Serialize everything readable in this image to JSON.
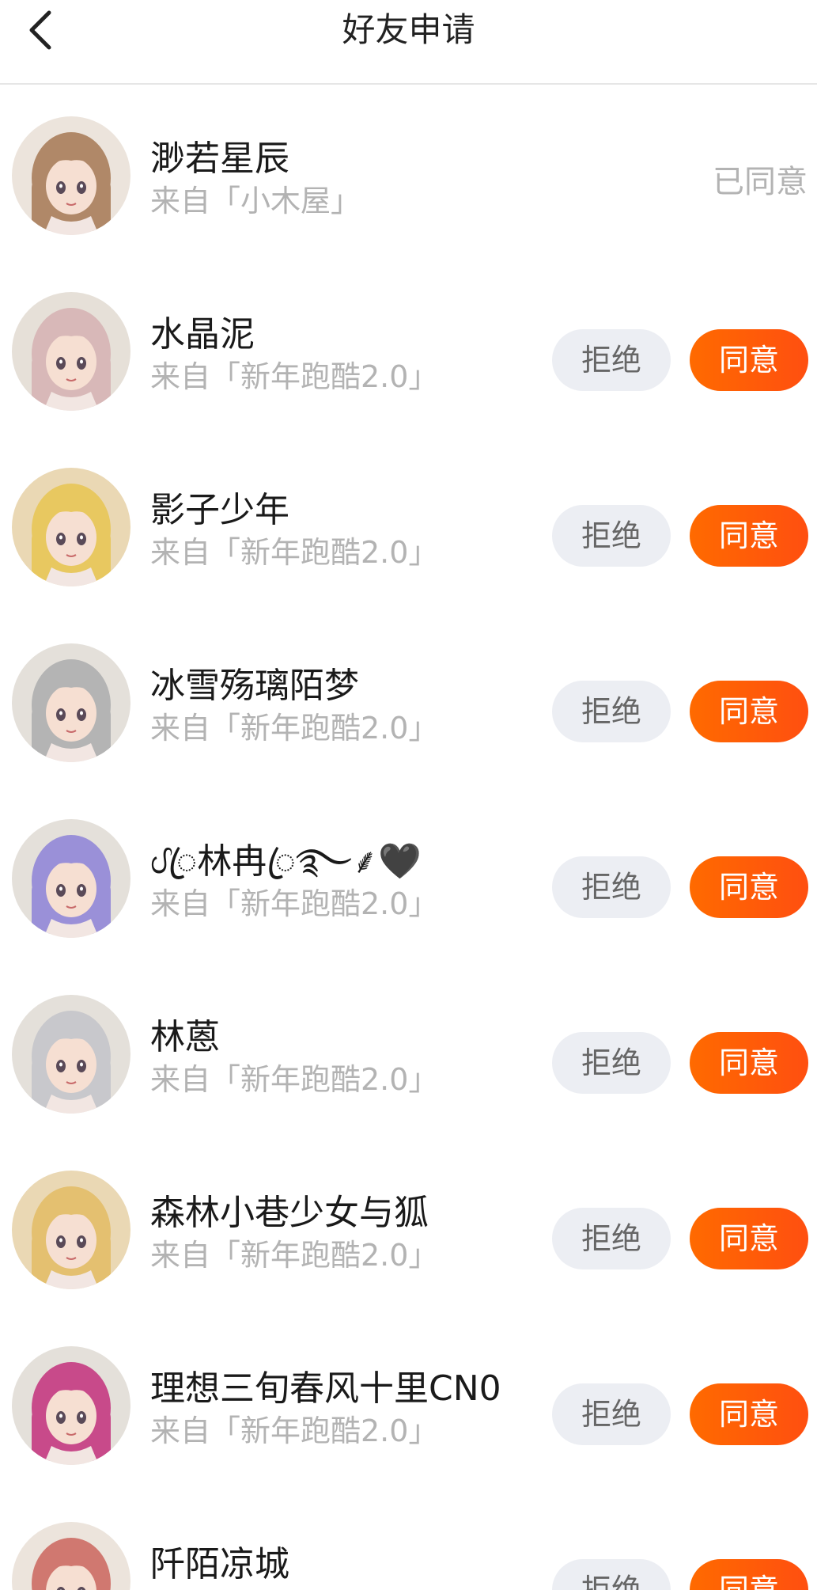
{
  "header": {
    "title": "好友申请",
    "back_icon": "chevron-left-icon"
  },
  "colors": {
    "accent": "#ff5a0a",
    "reject_bg": "#eceef3",
    "secondary_text": "#b3b3b3"
  },
  "requests": [
    {
      "name": "渺若星辰",
      "source": "来自「小木屋」",
      "status": "已同意",
      "hair": "#b08868",
      "bg": "#ece4dc"
    },
    {
      "name": "水晶泥",
      "source": "来自「新年跑酷2.0」",
      "reject": "拒绝",
      "accept": "同意",
      "hair": "#d8b8b8",
      "bg": "#e6e0d8"
    },
    {
      "name": "影子少年",
      "source": "来自「新年跑酷2.0」",
      "reject": "拒绝",
      "accept": "同意",
      "hair": "#e8c860",
      "bg": "#ead8b4"
    },
    {
      "name": "冰雪殇璃陌梦",
      "source": "来自「新年跑酷2.0」",
      "reject": "拒绝",
      "accept": "同意",
      "hair": "#b4b4b4",
      "bg": "#e4e0da"
    },
    {
      "name": "ᦔꦿ林冉ꦿ࿐⸙🖤",
      "source": "来自「新年跑酷2.0」",
      "reject": "拒绝",
      "accept": "同意",
      "hair": "#9a90d8",
      "bg": "#e4e0da"
    },
    {
      "name": "林蒽",
      "source": "来自「新年跑酷2.0」",
      "reject": "拒绝",
      "accept": "同意",
      "hair": "#c8c8cc",
      "bg": "#e4e0da"
    },
    {
      "name": "森林小巷少女与狐",
      "source": "来自「新年跑酷2.0」",
      "reject": "拒绝",
      "accept": "同意",
      "hair": "#e4c070",
      "bg": "#ead8b4"
    },
    {
      "name": "理想三旬春风十里CN0",
      "source": "来自「新年跑酷2.0」",
      "reject": "拒绝",
      "accept": "同意",
      "hair": "#c84a8a",
      "bg": "#e4e0da"
    },
    {
      "name": "阡陌凉城",
      "source": "",
      "reject": "拒绝",
      "accept": "同意",
      "hair": "#d07870",
      "bg": "#ece4dc"
    }
  ]
}
